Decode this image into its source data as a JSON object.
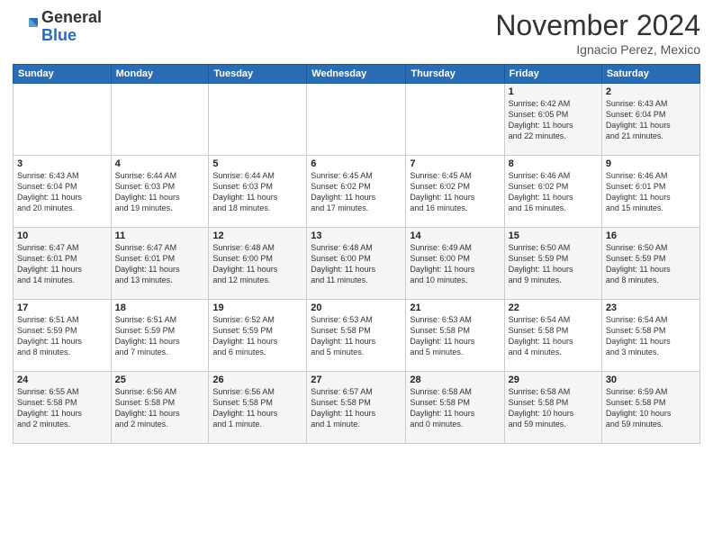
{
  "header": {
    "logo_general": "General",
    "logo_blue": "Blue",
    "month_title": "November 2024",
    "subtitle": "Ignacio Perez, Mexico"
  },
  "calendar": {
    "days_of_week": [
      "Sunday",
      "Monday",
      "Tuesday",
      "Wednesday",
      "Thursday",
      "Friday",
      "Saturday"
    ],
    "weeks": [
      [
        {
          "day": "",
          "info": ""
        },
        {
          "day": "",
          "info": ""
        },
        {
          "day": "",
          "info": ""
        },
        {
          "day": "",
          "info": ""
        },
        {
          "day": "",
          "info": ""
        },
        {
          "day": "1",
          "info": "Sunrise: 6:42 AM\nSunset: 6:05 PM\nDaylight: 11 hours\nand 22 minutes."
        },
        {
          "day": "2",
          "info": "Sunrise: 6:43 AM\nSunset: 6:04 PM\nDaylight: 11 hours\nand 21 minutes."
        }
      ],
      [
        {
          "day": "3",
          "info": "Sunrise: 6:43 AM\nSunset: 6:04 PM\nDaylight: 11 hours\nand 20 minutes."
        },
        {
          "day": "4",
          "info": "Sunrise: 6:44 AM\nSunset: 6:03 PM\nDaylight: 11 hours\nand 19 minutes."
        },
        {
          "day": "5",
          "info": "Sunrise: 6:44 AM\nSunset: 6:03 PM\nDaylight: 11 hours\nand 18 minutes."
        },
        {
          "day": "6",
          "info": "Sunrise: 6:45 AM\nSunset: 6:02 PM\nDaylight: 11 hours\nand 17 minutes."
        },
        {
          "day": "7",
          "info": "Sunrise: 6:45 AM\nSunset: 6:02 PM\nDaylight: 11 hours\nand 16 minutes."
        },
        {
          "day": "8",
          "info": "Sunrise: 6:46 AM\nSunset: 6:02 PM\nDaylight: 11 hours\nand 16 minutes."
        },
        {
          "day": "9",
          "info": "Sunrise: 6:46 AM\nSunset: 6:01 PM\nDaylight: 11 hours\nand 15 minutes."
        }
      ],
      [
        {
          "day": "10",
          "info": "Sunrise: 6:47 AM\nSunset: 6:01 PM\nDaylight: 11 hours\nand 14 minutes."
        },
        {
          "day": "11",
          "info": "Sunrise: 6:47 AM\nSunset: 6:01 PM\nDaylight: 11 hours\nand 13 minutes."
        },
        {
          "day": "12",
          "info": "Sunrise: 6:48 AM\nSunset: 6:00 PM\nDaylight: 11 hours\nand 12 minutes."
        },
        {
          "day": "13",
          "info": "Sunrise: 6:48 AM\nSunset: 6:00 PM\nDaylight: 11 hours\nand 11 minutes."
        },
        {
          "day": "14",
          "info": "Sunrise: 6:49 AM\nSunset: 6:00 PM\nDaylight: 11 hours\nand 10 minutes."
        },
        {
          "day": "15",
          "info": "Sunrise: 6:50 AM\nSunset: 5:59 PM\nDaylight: 11 hours\nand 9 minutes."
        },
        {
          "day": "16",
          "info": "Sunrise: 6:50 AM\nSunset: 5:59 PM\nDaylight: 11 hours\nand 8 minutes."
        }
      ],
      [
        {
          "day": "17",
          "info": "Sunrise: 6:51 AM\nSunset: 5:59 PM\nDaylight: 11 hours\nand 8 minutes."
        },
        {
          "day": "18",
          "info": "Sunrise: 6:51 AM\nSunset: 5:59 PM\nDaylight: 11 hours\nand 7 minutes."
        },
        {
          "day": "19",
          "info": "Sunrise: 6:52 AM\nSunset: 5:59 PM\nDaylight: 11 hours\nand 6 minutes."
        },
        {
          "day": "20",
          "info": "Sunrise: 6:53 AM\nSunset: 5:58 PM\nDaylight: 11 hours\nand 5 minutes."
        },
        {
          "day": "21",
          "info": "Sunrise: 6:53 AM\nSunset: 5:58 PM\nDaylight: 11 hours\nand 5 minutes."
        },
        {
          "day": "22",
          "info": "Sunrise: 6:54 AM\nSunset: 5:58 PM\nDaylight: 11 hours\nand 4 minutes."
        },
        {
          "day": "23",
          "info": "Sunrise: 6:54 AM\nSunset: 5:58 PM\nDaylight: 11 hours\nand 3 minutes."
        }
      ],
      [
        {
          "day": "24",
          "info": "Sunrise: 6:55 AM\nSunset: 5:58 PM\nDaylight: 11 hours\nand 2 minutes."
        },
        {
          "day": "25",
          "info": "Sunrise: 6:56 AM\nSunset: 5:58 PM\nDaylight: 11 hours\nand 2 minutes."
        },
        {
          "day": "26",
          "info": "Sunrise: 6:56 AM\nSunset: 5:58 PM\nDaylight: 11 hours\nand 1 minute."
        },
        {
          "day": "27",
          "info": "Sunrise: 6:57 AM\nSunset: 5:58 PM\nDaylight: 11 hours\nand 1 minute."
        },
        {
          "day": "28",
          "info": "Sunrise: 6:58 AM\nSunset: 5:58 PM\nDaylight: 11 hours\nand 0 minutes."
        },
        {
          "day": "29",
          "info": "Sunrise: 6:58 AM\nSunset: 5:58 PM\nDaylight: 10 hours\nand 59 minutes."
        },
        {
          "day": "30",
          "info": "Sunrise: 6:59 AM\nSunset: 5:58 PM\nDaylight: 10 hours\nand 59 minutes."
        }
      ]
    ]
  }
}
